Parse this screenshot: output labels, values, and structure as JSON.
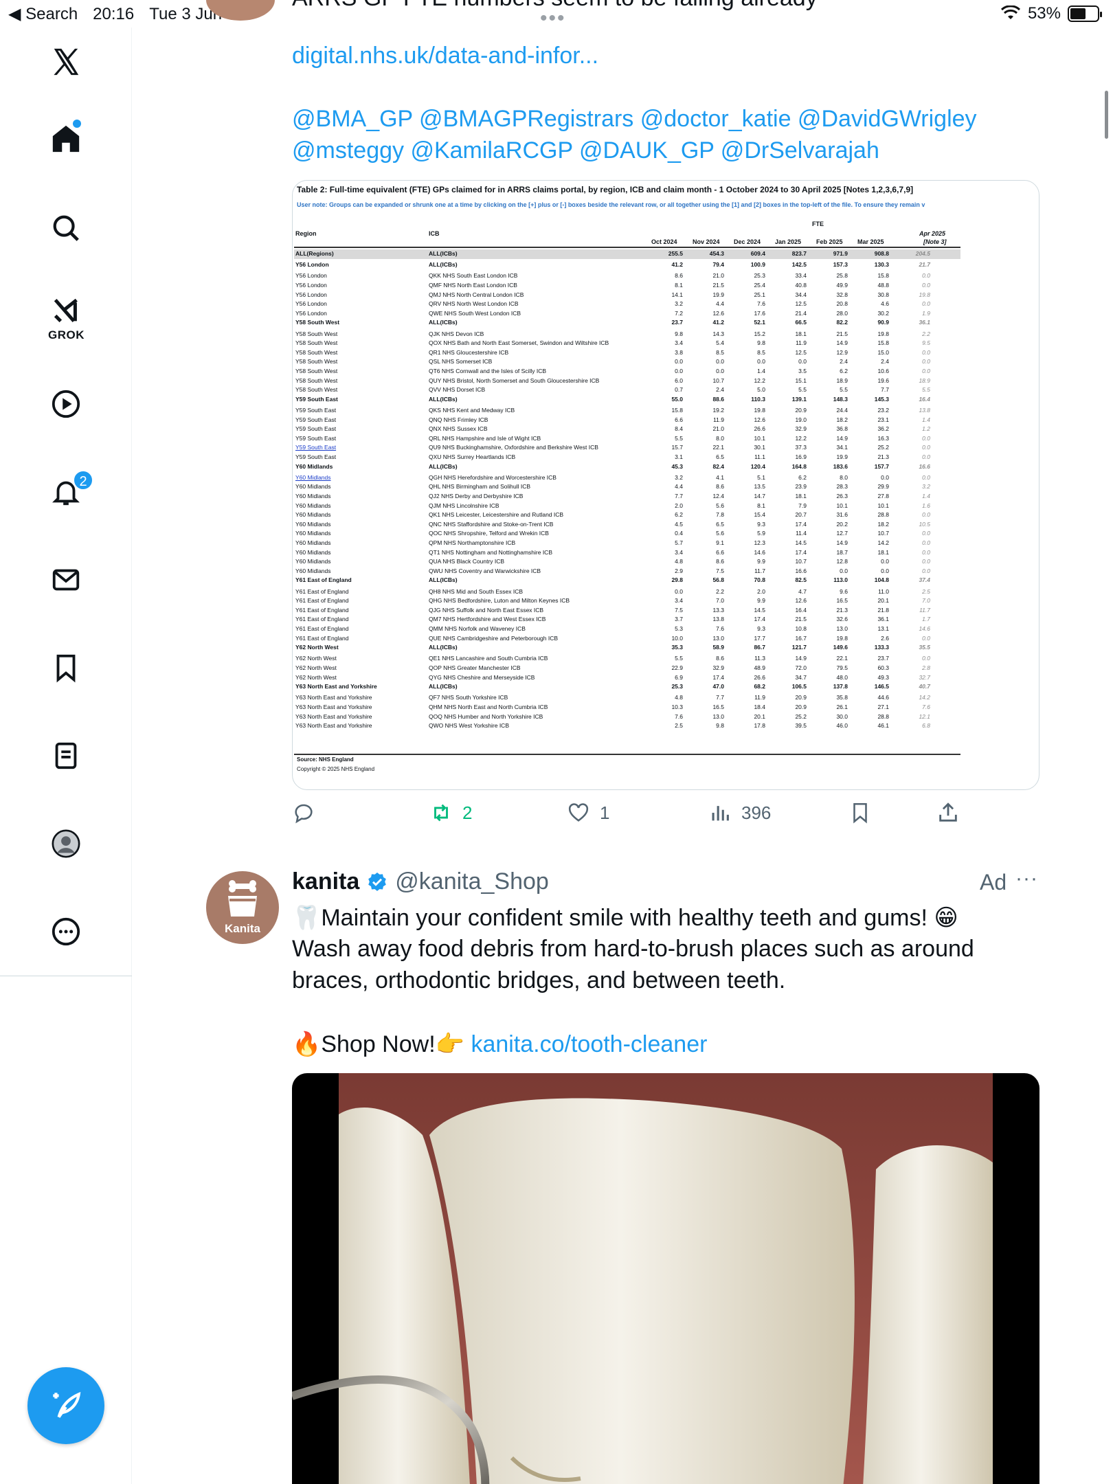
{
  "status_bar": {
    "back_label": "◀ Search",
    "time": "20:16",
    "date": "Tue 3 Jun",
    "battery": "53%"
  },
  "previous_tweet_fragment": "ARRS GP FTE numbers seem to be falling already",
  "sidebar": {
    "grok_label": "GROK",
    "notifications_count": "2",
    "items": [
      "x-logo",
      "home",
      "explore",
      "grok",
      "video",
      "notifications",
      "messages",
      "bookmarks",
      "lists",
      "profile",
      "more"
    ]
  },
  "tweet1": {
    "link_text": "digital.nhs.uk/data-and-infor...",
    "mentions_line1": "@BMA_GP @BMAGPRegistrars @doctor_katie @DavidGWrigley",
    "mentions_line2": "@msteggy @KamilaRCGP @DAUK_GP @DrSelvarajah",
    "table": {
      "title": "Table 2: Full-time equivalent (FTE) GPs claimed for in ARRS claims portal, by region, ICB and claim month - 1 October 2024 to 30 April 2025 [Notes 1,2,3,6,7,9]",
      "note": "User note: Groups can be expanded or shrunk one at a time by clicking on the [+] plus or [-] boxes beside the relevant row, or all together using the [1] and [2] boxes in the top-left of the file. To ensure they remain v",
      "fte_label": "FTE",
      "col_region": "Region",
      "col_icb": "ICB",
      "months": [
        "Oct 2024",
        "Nov 2024",
        "Dec 2024",
        "Jan 2025",
        "Feb 2025",
        "Mar 2025"
      ],
      "apr_label_1": "Apr 2025",
      "apr_label_2": "[Note 3]",
      "source": "Source: NHS England",
      "copyright": "Copyright © 2025 NHS England",
      "rows": [
        {
          "r": "ALL(Regions)",
          "i": "ALL(ICBs)",
          "v": [
            "255.5",
            "454.3",
            "609.4",
            "823.7",
            "971.9",
            "908.8",
            "204.5"
          ],
          "t": "total"
        },
        {
          "r": "Y56 London",
          "i": "ALL(ICBs)",
          "v": [
            "41.2",
            "79.4",
            "100.9",
            "142.5",
            "157.3",
            "130.3",
            "21.7"
          ],
          "t": "bold"
        },
        {
          "r": "Y56 London",
          "i": "QKK NHS South East London ICB",
          "v": [
            "8.6",
            "21.0",
            "25.3",
            "33.4",
            "25.8",
            "15.8",
            "0.0"
          ]
        },
        {
          "r": "Y56 London",
          "i": "QMF NHS North East London ICB",
          "v": [
            "8.1",
            "21.5",
            "25.4",
            "40.8",
            "49.9",
            "48.8",
            "0.0"
          ]
        },
        {
          "r": "Y56 London",
          "i": "QMJ NHS North Central London ICB",
          "v": [
            "14.1",
            "19.9",
            "25.1",
            "34.4",
            "32.8",
            "30.8",
            "19.8"
          ]
        },
        {
          "r": "Y56 London",
          "i": "QRV NHS North West London ICB",
          "v": [
            "3.2",
            "4.4",
            "7.6",
            "12.5",
            "20.8",
            "4.6",
            "0.0"
          ]
        },
        {
          "r": "Y56 London",
          "i": "QWE NHS South West London ICB",
          "v": [
            "7.2",
            "12.6",
            "17.6",
            "21.4",
            "28.0",
            "30.2",
            "1.9"
          ]
        },
        {
          "r": "Y58 South West",
          "i": "ALL(ICBs)",
          "v": [
            "23.7",
            "41.2",
            "52.1",
            "66.5",
            "82.2",
            "90.9",
            "36.1"
          ],
          "t": "bold"
        },
        {
          "r": "Y58 South West",
          "i": "QJK NHS Devon ICB",
          "v": [
            "9.8",
            "14.3",
            "15.2",
            "18.1",
            "21.5",
            "19.8",
            "2.2"
          ]
        },
        {
          "r": "Y58 South West",
          "i": "QOX NHS Bath and North East Somerset, Swindon and Wiltshire ICB",
          "v": [
            "3.4",
            "5.4",
            "9.8",
            "11.9",
            "14.9",
            "15.8",
            "9.5"
          ]
        },
        {
          "r": "Y58 South West",
          "i": "QR1 NHS Gloucestershire ICB",
          "v": [
            "3.8",
            "8.5",
            "8.5",
            "12.5",
            "12.9",
            "15.0",
            "0.0"
          ]
        },
        {
          "r": "Y58 South West",
          "i": "QSL NHS Somerset ICB",
          "v": [
            "0.0",
            "0.0",
            "0.0",
            "0.0",
            "2.4",
            "2.4",
            "0.0"
          ]
        },
        {
          "r": "Y58 South West",
          "i": "QT6 NHS Cornwall and the Isles of Scilly ICB",
          "v": [
            "0.0",
            "0.0",
            "1.4",
            "3.5",
            "6.2",
            "10.6",
            "0.0"
          ]
        },
        {
          "r": "Y58 South West",
          "i": "QUY NHS Bristol, North Somerset and South Gloucestershire ICB",
          "v": [
            "6.0",
            "10.7",
            "12.2",
            "15.1",
            "18.9",
            "19.6",
            "18.9"
          ]
        },
        {
          "r": "Y58 South West",
          "i": "QVV NHS Dorset ICB",
          "v": [
            "0.7",
            "2.4",
            "5.0",
            "5.5",
            "5.5",
            "7.7",
            "5.5"
          ]
        },
        {
          "r": "Y59 South East",
          "i": "ALL(ICBs)",
          "v": [
            "55.0",
            "88.6",
            "110.3",
            "139.1",
            "148.3",
            "145.3",
            "16.4"
          ],
          "t": "bold"
        },
        {
          "r": "Y59 South East",
          "i": "QKS NHS Kent and Medway ICB",
          "v": [
            "15.8",
            "19.2",
            "19.8",
            "20.9",
            "24.4",
            "23.2",
            "13.8"
          ]
        },
        {
          "r": "Y59 South East",
          "i": "QNQ NHS Frimley ICB",
          "v": [
            "6.6",
            "11.9",
            "12.6",
            "19.0",
            "18.2",
            "23.1",
            "1.4"
          ]
        },
        {
          "r": "Y59 South East",
          "i": "QNX NHS Sussex ICB",
          "v": [
            "8.4",
            "21.0",
            "26.6",
            "32.9",
            "36.8",
            "36.2",
            "1.2"
          ]
        },
        {
          "r": "Y59 South East",
          "i": "QRL NHS Hampshire and Isle of Wight ICB",
          "v": [
            "5.5",
            "8.0",
            "10.1",
            "12.2",
            "14.9",
            "16.3",
            "0.0"
          ]
        },
        {
          "r": "Y59 South East",
          "i": "QU9 NHS Buckinghamshire, Oxfordshire and Berkshire West ICB",
          "v": [
            "15.7",
            "22.1",
            "30.1",
            "37.3",
            "34.1",
            "25.2",
            "0.0"
          ],
          "link": true
        },
        {
          "r": "Y59 South East",
          "i": "QXU NHS Surrey Heartlands ICB",
          "v": [
            "3.1",
            "6.5",
            "11.1",
            "16.9",
            "19.9",
            "21.3",
            "0.0"
          ]
        },
        {
          "r": "Y60 Midlands",
          "i": "ALL(ICBs)",
          "v": [
            "45.3",
            "82.4",
            "120.4",
            "164.8",
            "183.6",
            "157.7",
            "16.6"
          ],
          "t": "bold"
        },
        {
          "r": "Y60 Midlands",
          "i": "QGH NHS Herefordshire and Worcestershire ICB",
          "v": [
            "3.2",
            "4.1",
            "5.1",
            "6.2",
            "8.0",
            "0.0",
            "0.0"
          ],
          "link": true
        },
        {
          "r": "Y60 Midlands",
          "i": "QHL NHS Birmingham and Solihull ICB",
          "v": [
            "4.4",
            "8.6",
            "13.5",
            "23.9",
            "28.3",
            "29.9",
            "3.2"
          ]
        },
        {
          "r": "Y60 Midlands",
          "i": "QJ2 NHS Derby and Derbyshire ICB",
          "v": [
            "7.7",
            "12.4",
            "14.7",
            "18.1",
            "26.3",
            "27.8",
            "1.4"
          ]
        },
        {
          "r": "Y60 Midlands",
          "i": "QJM NHS Lincolnshire ICB",
          "v": [
            "2.0",
            "5.6",
            "8.1",
            "7.9",
            "10.1",
            "10.1",
            "1.6"
          ]
        },
        {
          "r": "Y60 Midlands",
          "i": "QK1 NHS Leicester, Leicestershire and Rutland ICB",
          "v": [
            "6.2",
            "7.8",
            "15.4",
            "20.7",
            "31.6",
            "28.8",
            "0.0"
          ]
        },
        {
          "r": "Y60 Midlands",
          "i": "QNC NHS Staffordshire and Stoke-on-Trent ICB",
          "v": [
            "4.5",
            "6.5",
            "9.3",
            "17.4",
            "20.2",
            "18.2",
            "10.5"
          ]
        },
        {
          "r": "Y60 Midlands",
          "i": "QOC NHS Shropshire, Telford and Wrekin ICB",
          "v": [
            "0.4",
            "5.6",
            "5.9",
            "11.4",
            "12.7",
            "10.7",
            "0.0"
          ]
        },
        {
          "r": "Y60 Midlands",
          "i": "QPM NHS Northamptonshire ICB",
          "v": [
            "5.7",
            "9.1",
            "12.3",
            "14.5",
            "14.9",
            "14.2",
            "0.0"
          ]
        },
        {
          "r": "Y60 Midlands",
          "i": "QT1 NHS Nottingham and Nottinghamshire ICB",
          "v": [
            "3.4",
            "6.6",
            "14.6",
            "17.4",
            "18.7",
            "18.1",
            "0.0"
          ]
        },
        {
          "r": "Y60 Midlands",
          "i": "QUA NHS Black Country ICB",
          "v": [
            "4.8",
            "8.6",
            "9.9",
            "10.7",
            "12.8",
            "0.0",
            "0.0"
          ]
        },
        {
          "r": "Y60 Midlands",
          "i": "QWU NHS Coventry and Warwickshire ICB",
          "v": [
            "2.9",
            "7.5",
            "11.7",
            "16.6",
            "0.0",
            "0.0",
            "0.0"
          ]
        },
        {
          "r": "Y61 East of England",
          "i": "ALL(ICBs)",
          "v": [
            "29.8",
            "56.8",
            "70.8",
            "82.5",
            "113.0",
            "104.8",
            "37.4"
          ],
          "t": "bold"
        },
        {
          "r": "Y61 East of England",
          "i": "QH8 NHS Mid and South Essex ICB",
          "v": [
            "0.0",
            "2.2",
            "2.0",
            "4.7",
            "9.6",
            "11.0",
            "2.5"
          ]
        },
        {
          "r": "Y61 East of England",
          "i": "QHG NHS Bedfordshire, Luton and Milton Keynes ICB",
          "v": [
            "3.4",
            "7.0",
            "9.9",
            "12.6",
            "16.5",
            "20.1",
            "7.0"
          ]
        },
        {
          "r": "Y61 East of England",
          "i": "QJG NHS Suffolk and North East Essex ICB",
          "v": [
            "7.5",
            "13.3",
            "14.5",
            "16.4",
            "21.3",
            "21.8",
            "11.7"
          ]
        },
        {
          "r": "Y61 East of England",
          "i": "QM7 NHS Hertfordshire and West Essex ICB",
          "v": [
            "3.7",
            "13.8",
            "17.4",
            "21.5",
            "32.6",
            "36.1",
            "1.7"
          ]
        },
        {
          "r": "Y61 East of England",
          "i": "QMM NHS Norfolk and Waveney ICB",
          "v": [
            "5.3",
            "7.6",
            "9.3",
            "10.8",
            "13.0",
            "13.1",
            "14.6"
          ]
        },
        {
          "r": "Y61 East of England",
          "i": "QUE NHS Cambridgeshire and Peterborough ICB",
          "v": [
            "10.0",
            "13.0",
            "17.7",
            "16.7",
            "19.8",
            "2.6",
            "0.0"
          ]
        },
        {
          "r": "Y62 North West",
          "i": "ALL(ICBs)",
          "v": [
            "35.3",
            "58.9",
            "86.7",
            "121.7",
            "149.6",
            "133.3",
            "35.5"
          ],
          "t": "bold"
        },
        {
          "r": "Y62 North West",
          "i": "QE1 NHS Lancashire and South Cumbria ICB",
          "v": [
            "5.5",
            "8.6",
            "11.3",
            "14.9",
            "22.1",
            "23.7",
            "0.0"
          ]
        },
        {
          "r": "Y62 North West",
          "i": "QOP NHS Greater Manchester ICB",
          "v": [
            "22.9",
            "32.9",
            "48.9",
            "72.0",
            "79.5",
            "60.3",
            "2.8"
          ]
        },
        {
          "r": "Y62 North West",
          "i": "QYG NHS Cheshire and Merseyside ICB",
          "v": [
            "6.9",
            "17.4",
            "26.6",
            "34.7",
            "48.0",
            "49.3",
            "32.7"
          ]
        },
        {
          "r": "Y63 North East and Yorkshire",
          "i": "ALL(ICBs)",
          "v": [
            "25.3",
            "47.0",
            "68.2",
            "106.5",
            "137.8",
            "146.5",
            "40.7"
          ],
          "t": "bold"
        },
        {
          "r": "Y63 North East and Yorkshire",
          "i": "QF7 NHS South Yorkshire ICB",
          "v": [
            "4.8",
            "7.7",
            "11.9",
            "20.9",
            "35.8",
            "44.6",
            "14.2"
          ]
        },
        {
          "r": "Y63 North East and Yorkshire",
          "i": "QHM NHS North East and North Cumbria ICB",
          "v": [
            "10.3",
            "16.5",
            "18.4",
            "20.9",
            "26.1",
            "27.1",
            "7.6"
          ]
        },
        {
          "r": "Y63 North East and Yorkshire",
          "i": "QOQ NHS Humber and North Yorkshire ICB",
          "v": [
            "7.6",
            "13.0",
            "20.1",
            "25.2",
            "30.0",
            "28.8",
            "12.1"
          ]
        },
        {
          "r": "Y63 North East and Yorkshire",
          "i": "QWO NHS West Yorkshire ICB",
          "v": [
            "2.5",
            "9.8",
            "17.8",
            "39.5",
            "46.0",
            "46.1",
            "6.8"
          ]
        }
      ]
    },
    "actions": {
      "reply_count": "",
      "repost_count": "2",
      "like_count": "1",
      "views_count": "396"
    }
  },
  "tweet2": {
    "avatar_label": "Kanita",
    "name": "kanita",
    "handle": "@kanita_Shop",
    "ad_label": "Ad",
    "more": "···",
    "line1": "🦷Maintain your confident smile with healthy teeth and gums! 😁",
    "line2": "Wash away food debris from hard-to-brush places such as around",
    "line3": "braces, orthodontic bridges, and between teeth.",
    "shop_prefix": "🔥Shop Now!👉 ",
    "shop_link": "kanita.co/tooth-cleaner"
  },
  "colors": {
    "accent": "#1d9bf0",
    "repost_green": "#00ba7c",
    "text": "#0f1419",
    "muted": "#536471"
  }
}
